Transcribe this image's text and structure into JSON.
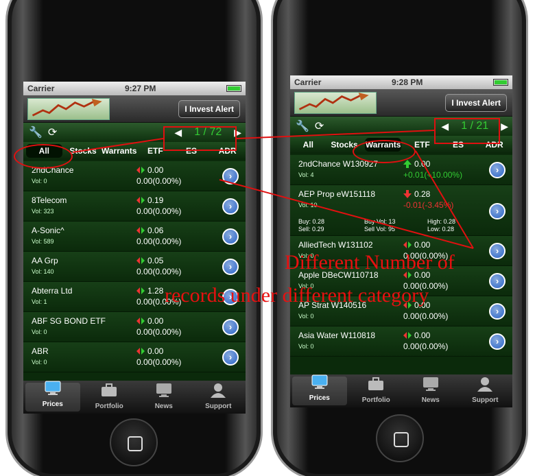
{
  "annotation": {
    "caption_line1": "Different Number of",
    "caption_line2": "records under different category",
    "color": "#e01010"
  },
  "left": {
    "status": {
      "carrier": "Carrier",
      "time": "9:27 PM"
    },
    "header": {
      "alert_button": "I Invest Alert"
    },
    "pager": {
      "text": "1 / 72"
    },
    "tabs": [
      "All",
      "Stocks",
      "Warrants",
      "ETF",
      "ES",
      "ADR"
    ],
    "selected_tab": "All",
    "rows": [
      {
        "name": "2ndChance",
        "vol": "Vol: 0",
        "price": "0.00",
        "change": "0.00(0.00%)"
      },
      {
        "name": "8Telecom",
        "vol": "Vol: 323",
        "price": "0.19",
        "change": "0.00(0.00%)"
      },
      {
        "name": "A-Sonic^",
        "vol": "Vol: 589",
        "price": "0.06",
        "change": "0.00(0.00%)"
      },
      {
        "name": "AA Grp",
        "vol": "Vol: 140",
        "price": "0.05",
        "change": "0.00(0.00%)"
      },
      {
        "name": "Abterra Ltd",
        "vol": "Vol: 1",
        "price": "1.28",
        "change": "0.00(0.00%)"
      },
      {
        "name": "ABF SG BOND ETF",
        "vol": "Vol: 0",
        "price": "0.00",
        "change": "0.00(0.00%)"
      },
      {
        "name": "ABR",
        "vol": "Vol: 0",
        "price": "0.00",
        "change": "0.00(0.00%)"
      }
    ],
    "bottom_tabs": [
      "Prices",
      "Portfolio",
      "News",
      "Support"
    ]
  },
  "right": {
    "status": {
      "carrier": "Carrier",
      "time": "9:28 PM"
    },
    "header": {
      "alert_button": "I Invest Alert"
    },
    "pager": {
      "text": "1 / 21"
    },
    "tabs": [
      "All",
      "Stocks",
      "Warrants",
      "ETF",
      "ES",
      "ADR"
    ],
    "selected_tab": "Warrants",
    "rows": [
      {
        "name": "2ndChance W130927",
        "vol": "Vol: 4",
        "price": "0.00",
        "change": "+0.01(+10.00%)",
        "trend": "up"
      },
      {
        "name": "AEP Prop eW151118",
        "vol": "Vol: 10",
        "price": "0.28",
        "change": "-0.01(-3.45%)",
        "trend": "down",
        "details": {
          "buy": "Buy: 0.28",
          "sell": "Sell: 0.29",
          "buy_vol": "Buy Vol: 13",
          "sell_vol": "Sell Vol: 95",
          "high": "High: 0.28",
          "low": "Low: 0.28"
        }
      },
      {
        "name": "AlliedTech W131102",
        "vol": "Vol: 0",
        "price": "0.00",
        "change": "0.00(0.00%)"
      },
      {
        "name": "Apple DBeCW110718",
        "vol": "Vol: 0",
        "price": "0.00",
        "change": "0.00(0.00%)"
      },
      {
        "name": "AP Strat W140516",
        "vol": "Vol: 0",
        "price": "0.00",
        "change": "0.00(0.00%)"
      },
      {
        "name": "Asia Water W110818",
        "vol": "Vol: 0",
        "price": "0.00",
        "change": "0.00(0.00%)"
      }
    ],
    "bottom_tabs": [
      "Prices",
      "Portfolio",
      "News",
      "Support"
    ]
  }
}
